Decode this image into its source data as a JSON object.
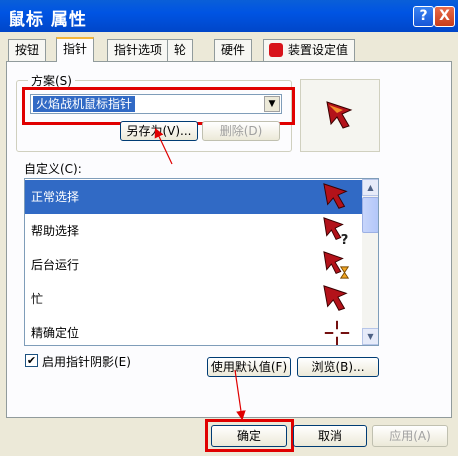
{
  "window": {
    "title": "鼠标 属性",
    "help_btn": "?",
    "close_btn": "X"
  },
  "tabs": [
    "按钮",
    "指针",
    "指针选项",
    "轮",
    "硬件",
    "装置设定值"
  ],
  "scheme": {
    "label": "方案(S)",
    "selected": "火焰战机鼠标指针",
    "save_as": "另存为(V)...",
    "delete": "删除(D)"
  },
  "custom_label": "自定义(C):",
  "list_items": [
    "正常选择",
    "帮助选择",
    "后台运行",
    "忙",
    "精确定位"
  ],
  "shadow_label": "启用指针阴影(E)",
  "buttons": {
    "use_default": "使用默认值(F)",
    "browse": "浏览(B)...",
    "ok": "确定",
    "cancel": "取消",
    "apply": "应用(A)"
  },
  "colors": {
    "title_bar": "#0054e3",
    "selection": "#316ac5",
    "annotation": "#e00000"
  }
}
